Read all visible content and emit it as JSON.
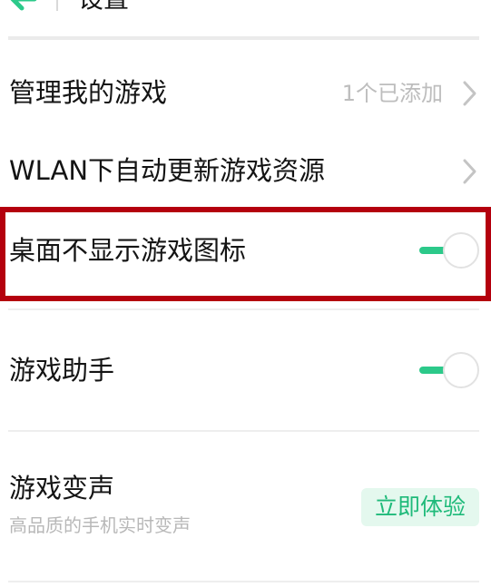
{
  "header": {
    "title": "设置"
  },
  "rows": [
    {
      "label": "管理我的游戏",
      "value": "1个已添加"
    },
    {
      "label": "WLAN下自动更新游戏资源"
    },
    {
      "label": "桌面不显示游戏图标",
      "toggle": "on"
    },
    {
      "label": "游戏助手",
      "toggle": "on"
    },
    {
      "label": "游戏变声",
      "sublabel": "高品质的手机实时变声",
      "button": "立即体验"
    }
  ],
  "colors": {
    "accent": "#2cc98a",
    "highlight_border": "#b4000e",
    "button_bg": "#e4f8ee",
    "button_text": "#1fba7a"
  },
  "icons": {
    "back": "arrow-left-icon",
    "chevron": "chevron-right-icon"
  }
}
